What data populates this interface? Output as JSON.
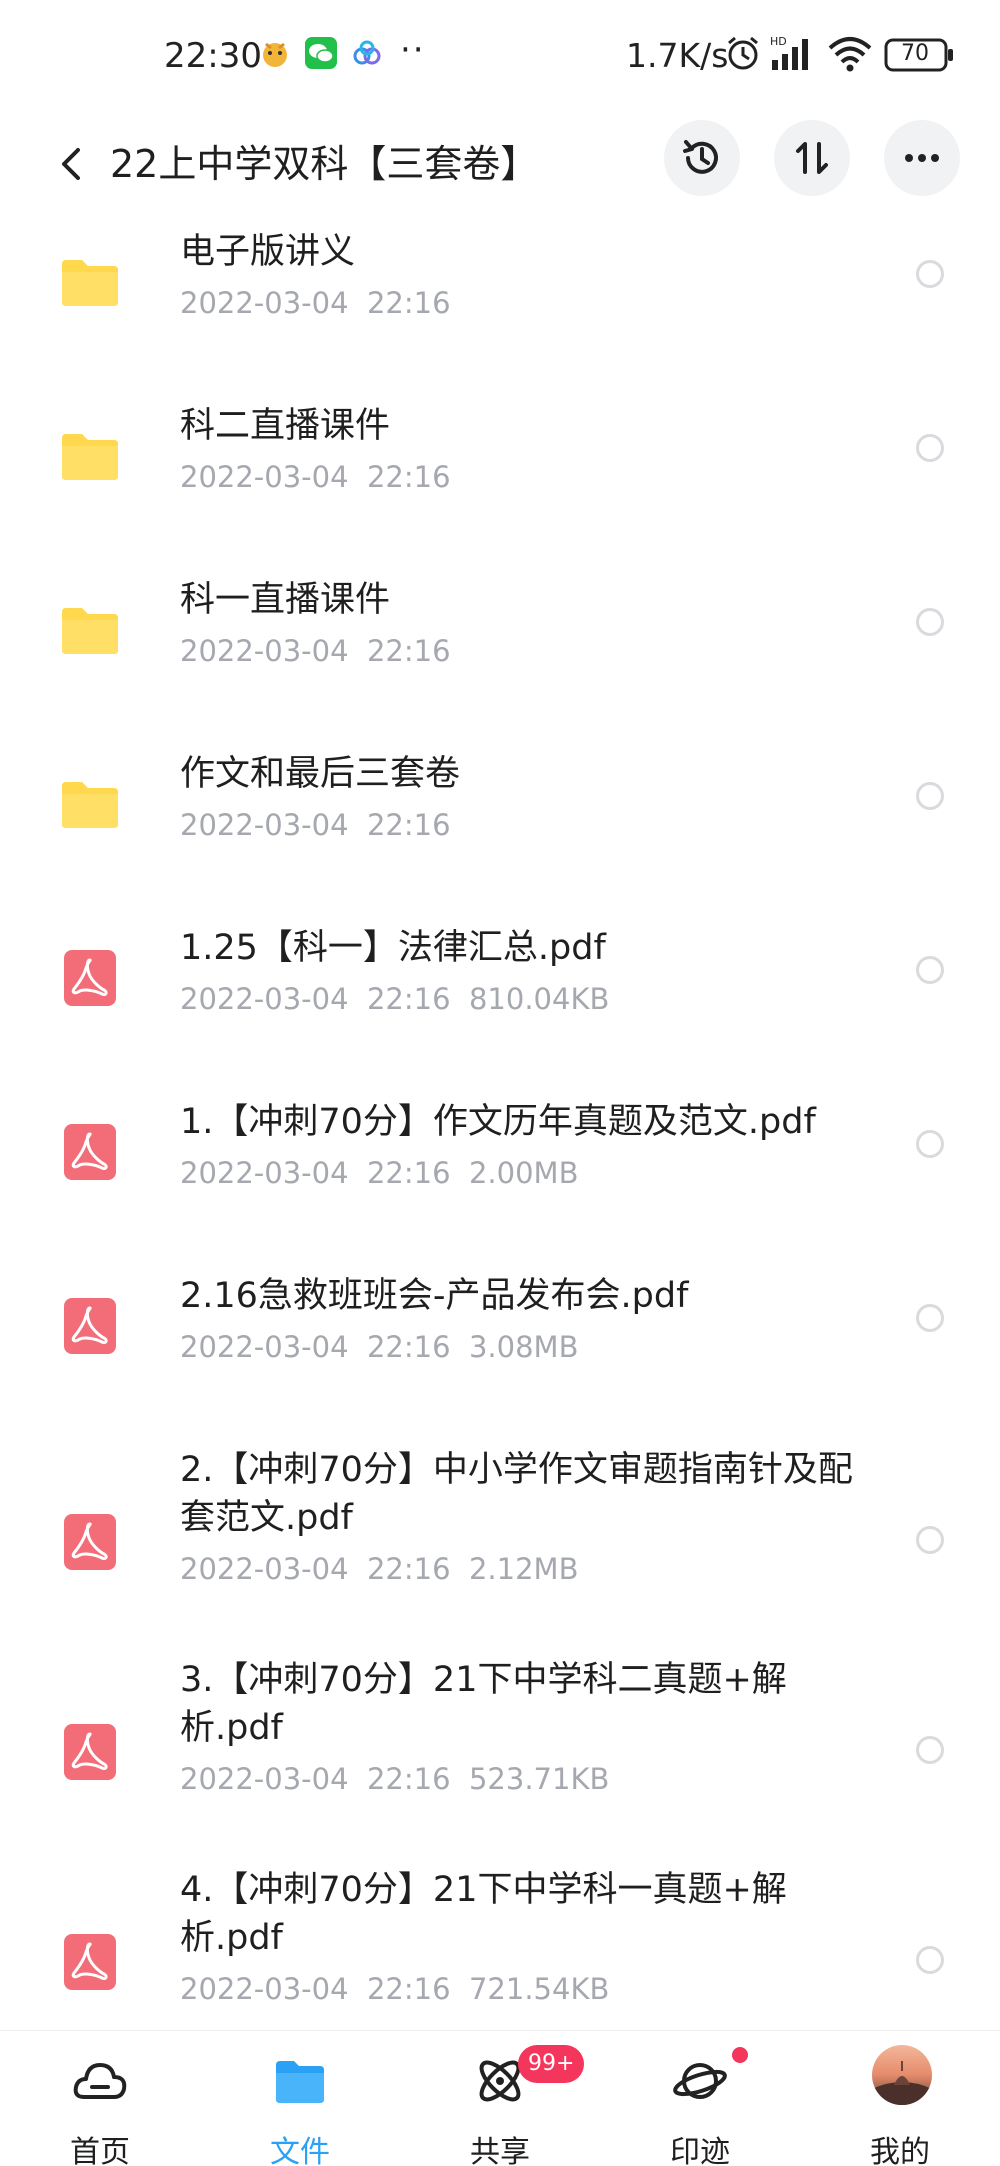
{
  "status_bar": {
    "time": "22:30",
    "more": "··",
    "net_speed": "1.7K/s",
    "battery": "70",
    "notification_icons": [
      "pet-app-icon",
      "wechat-icon",
      "cloud-app-icon"
    ]
  },
  "header": {
    "title": "22上中学双科【三套卷】",
    "icons": [
      "back-arrow-icon",
      "history-icon",
      "sort-icon",
      "more-icon"
    ]
  },
  "files": [
    {
      "name": "电子版讲义",
      "meta": "2022-03-04  22:16",
      "type": "folder"
    },
    {
      "name": "科二直播课件",
      "meta": "2022-03-04  22:16",
      "type": "folder"
    },
    {
      "name": "科一直播课件",
      "meta": "2022-03-04  22:16",
      "type": "folder"
    },
    {
      "name": "作文和最后三套卷",
      "meta": "2022-03-04  22:16",
      "type": "folder"
    },
    {
      "name": "1.25【科一】法律汇总.pdf",
      "meta": "2022-03-04  22:16  810.04KB",
      "type": "pdf"
    },
    {
      "name": "1.【冲刺70分】作文历年真题及范文.pdf",
      "meta": "2022-03-04  22:16  2.00MB",
      "type": "pdf"
    },
    {
      "name": "2.16急救班班会-产品发布会.pdf",
      "meta": "2022-03-04  22:16  3.08MB",
      "type": "pdf"
    },
    {
      "name": "2.【冲刺70分】中小学作文审题指南针及配套范文.pdf",
      "meta": "2022-03-04  22:16  2.12MB",
      "type": "pdf"
    },
    {
      "name": "3.【冲刺70分】21下中学科二真题+解析.pdf",
      "meta": "2022-03-04  22:16  523.71KB",
      "type": "pdf"
    },
    {
      "name": "4.【冲刺70分】21下中学科一真题+解析.pdf",
      "meta": "2022-03-04  22:16  721.54KB",
      "type": "pdf"
    }
  ],
  "bottom_nav": {
    "items": [
      {
        "label": "首页",
        "icon": "cloud-home-icon"
      },
      {
        "label": "文件",
        "icon": "folder-icon"
      },
      {
        "label": "共享",
        "icon": "atom-share-icon"
      },
      {
        "label": "印迹",
        "icon": "planet-icon"
      },
      {
        "label": "我的",
        "icon": "avatar"
      }
    ],
    "share_badge": "99+",
    "active": "文件"
  },
  "colors": {
    "folder": "#FFD84D",
    "pdf": "#F26D78",
    "accent": "#2AA1F5",
    "meta_text": "#A6A8B0",
    "badge": "#F5365C"
  }
}
